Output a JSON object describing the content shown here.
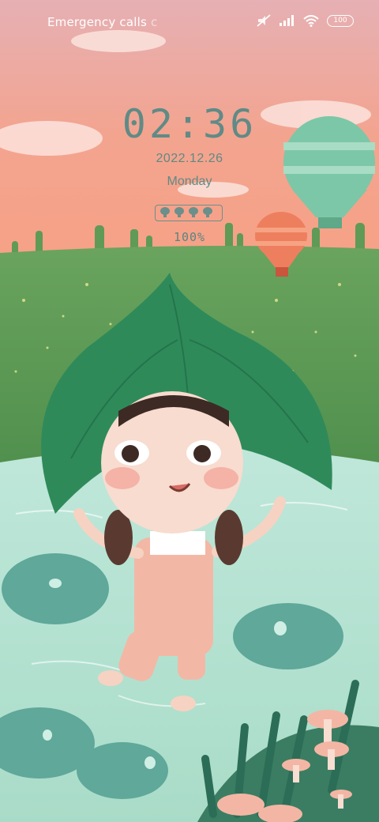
{
  "status_bar": {
    "carrier_text": "Emergency calls",
    "carrier_overflow": "c",
    "battery_level": "100",
    "icons": [
      "mute-icon",
      "signal-icon",
      "wifi-icon",
      "battery-icon"
    ]
  },
  "lock_screen": {
    "time": "02:36",
    "date": "2022.12.26",
    "weekday": "Monday",
    "battery_percent": "100%"
  },
  "wallpaper": {
    "description_icons": [
      "hot-air-balloon-icon",
      "leaf-umbrella-girl-illustration",
      "lily-pad-icon",
      "mushroom-icon"
    ],
    "colors": {
      "sky": "#f4a08a",
      "grass": "#5f9a56",
      "water": "#c8ebdf",
      "leaf": "#2f8a5a",
      "accent_text": "#5f8a85"
    }
  }
}
